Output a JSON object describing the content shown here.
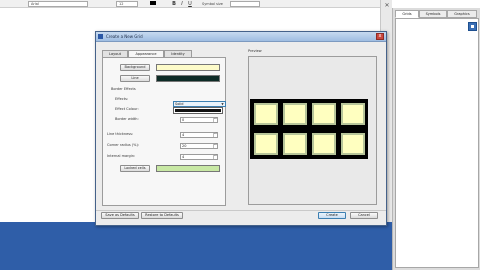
{
  "toolbar": {
    "font_name": "Arial",
    "font_size": "12",
    "btn_bold": "B",
    "btn_italic": "I",
    "btn_underline": "U",
    "symbol_label": "Symbol size"
  },
  "side_panel": {
    "close_glyph": "✕",
    "tabs": [
      {
        "label": "Grids",
        "active": true
      },
      {
        "label": "Symbols",
        "active": false
      },
      {
        "label": "Graphics",
        "active": false
      }
    ]
  },
  "dialog": {
    "title": "Create a New Grid",
    "close_glyph": "x",
    "tabs": [
      {
        "label": "Layout",
        "active": false
      },
      {
        "label": "Appearance",
        "active": true
      },
      {
        "label": "Identity",
        "active": false
      }
    ],
    "background_button": "Background",
    "background_color": "#fdfbc9",
    "line_button": "Line",
    "line_color": "#0d2b26",
    "border_effects_label": "Border Effects",
    "effects_label": "Effects:",
    "effects_value": "Solid",
    "effect_colour_label": "Effect Colour:",
    "border_width_label": "Border width:",
    "border_width_value": "0",
    "line_thickness_label": "Line thickness:",
    "line_thickness_value": "4",
    "corner_radius_label": "Corner radius (%):",
    "corner_radius_value": "20",
    "internal_margin_label": "Internal margin:",
    "internal_margin_value": "4",
    "locked_cells_button": "Locked cells",
    "locked_cells_color": "#c8e8a4",
    "preview_label": "Preview",
    "save_defaults_button": "Save as Defaults",
    "restore_defaults_button": "Restore to Defaults",
    "create_button": "Create",
    "cancel_button": "Cancel"
  },
  "colors": {
    "accent": "#3c7fb1",
    "bottom_band": "#2f5ea8",
    "preview_cell": "#ffffc0"
  }
}
